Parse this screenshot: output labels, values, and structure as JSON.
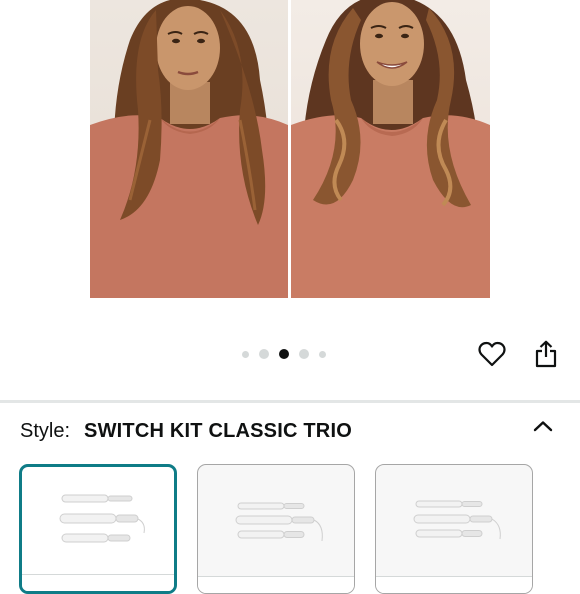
{
  "gallery": {
    "image_count": 5,
    "active_index": 2
  },
  "actions": {
    "wishlist_icon": "heart-icon",
    "share_icon": "share-icon"
  },
  "style_selector": {
    "label": "Style:",
    "selected_value": "SWITCH KIT CLASSIC TRIO",
    "toggle_icon": "chevron-up-icon",
    "options_count": 3,
    "selected_option_index": 0
  },
  "colors": {
    "selected_border": "#0f7c87",
    "text": "#0f1111",
    "shirt": "#c87b63",
    "hair": "#7a4a2a"
  }
}
